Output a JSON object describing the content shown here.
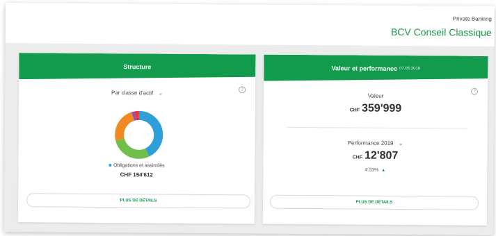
{
  "header": {
    "brand_small": "Private Banking",
    "brand_title": "BCV Conseil Classique"
  },
  "structure_card": {
    "title": "Structure",
    "help": "?",
    "dropdown_label": "Par classe d'actif",
    "legend_label": "Obligations et assimilés",
    "legend_value": "CHF 154'612",
    "details_button": "PLUS DE DÉTAILS",
    "donut_colors": {
      "blue": "#2e9fd8",
      "green": "#6fbf4a",
      "orange": "#f08a24",
      "purple": "#8e4fb5",
      "red": "#e8383d"
    }
  },
  "value_card": {
    "title": "Valeur et performance",
    "date": "07.05.2019",
    "help": "?",
    "value_label": "Valeur",
    "value_currency": "CHF",
    "value_amount": "359'999",
    "performance_dropdown": "Performance 2019",
    "performance_currency": "CHF",
    "performance_amount": "12'807",
    "performance_percent": "4.31%",
    "details_button": "PLUS DE DÉTAILS"
  },
  "colors": {
    "accent_green": "#129a4d",
    "brand_green": "#1a9a4b",
    "background": "#ececec"
  }
}
